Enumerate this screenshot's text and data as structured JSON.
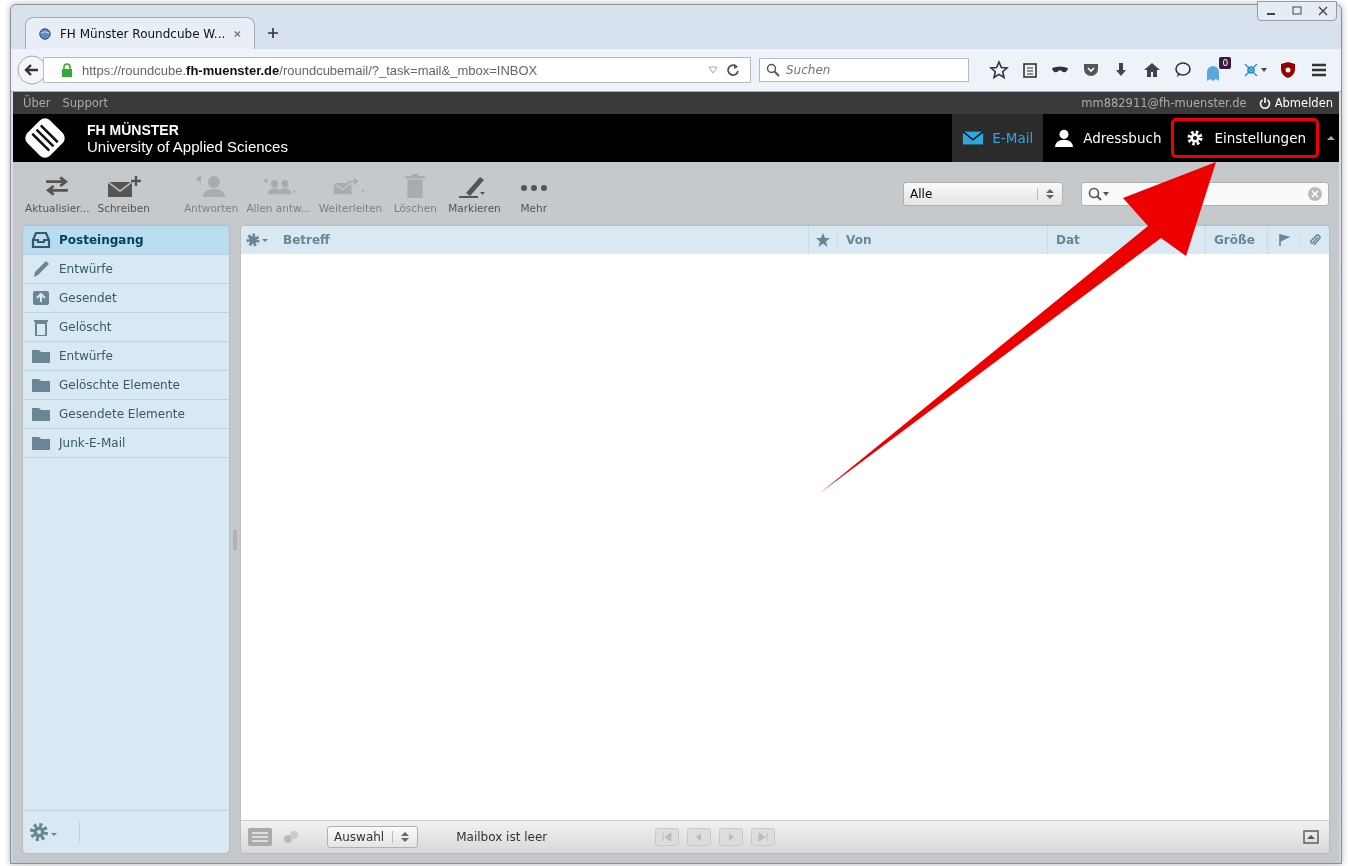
{
  "browser": {
    "tab": {
      "title": "FH Münster Roundcube W..."
    },
    "url": {
      "prefix": "https://roundcube.",
      "domain": "fh-muenster.de",
      "path": "/roundcubemail/?_task=mail&_mbox=INBOX"
    },
    "search": {
      "placeholder": "Suchen"
    },
    "badge": "0"
  },
  "topbar": {
    "links": [
      "Über",
      "Support"
    ],
    "user": "mm882911@fh-muenster.de",
    "logout": "Abmelden"
  },
  "header": {
    "logo_line1": "FH MÜNSTER",
    "logo_line2": "University of Applied Sciences",
    "nav": [
      {
        "label": "E-Mail",
        "kind": "mail",
        "selected": true,
        "highlighted": false
      },
      {
        "label": "Adressbuch",
        "kind": "contacts",
        "selected": false,
        "highlighted": false
      },
      {
        "label": "Einstellungen",
        "kind": "settings",
        "selected": false,
        "highlighted": true
      }
    ]
  },
  "toolbar": {
    "buttons": [
      {
        "label": "Aktualisier...",
        "kind": "refresh",
        "disabled": false
      },
      {
        "label": "Schreiben",
        "kind": "compose",
        "disabled": false
      },
      {
        "label": "Antworten",
        "kind": "reply",
        "disabled": true
      },
      {
        "label": "Allen antw...",
        "kind": "replyall",
        "disabled": true
      },
      {
        "label": "Weiterleiten",
        "kind": "forward",
        "disabled": true
      },
      {
        "label": "Löschen",
        "kind": "delete",
        "disabled": true
      },
      {
        "label": "Markieren",
        "kind": "mark",
        "disabled": false
      },
      {
        "label": "Mehr",
        "kind": "more",
        "disabled": false
      }
    ],
    "filter": "Alle"
  },
  "folders": [
    {
      "label": "Posteingang",
      "kind": "inbox",
      "selected": true
    },
    {
      "label": "Entwürfe",
      "kind": "drafts",
      "selected": false
    },
    {
      "label": "Gesendet",
      "kind": "sent",
      "selected": false
    },
    {
      "label": "Gelöscht",
      "kind": "trash",
      "selected": false
    },
    {
      "label": "Entwürfe",
      "kind": "folder",
      "selected": false
    },
    {
      "label": "Gelöschte Elemente",
      "kind": "folder",
      "selected": false
    },
    {
      "label": "Gesendete Elemente",
      "kind": "folder",
      "selected": false
    },
    {
      "label": "Junk-E-Mail",
      "kind": "folder",
      "selected": false
    }
  ],
  "table": {
    "columns": [
      "Betreff",
      "Von",
      "Dat",
      "Größe"
    ]
  },
  "footer": {
    "select": "Auswahl",
    "status": "Mailbox ist leer"
  }
}
